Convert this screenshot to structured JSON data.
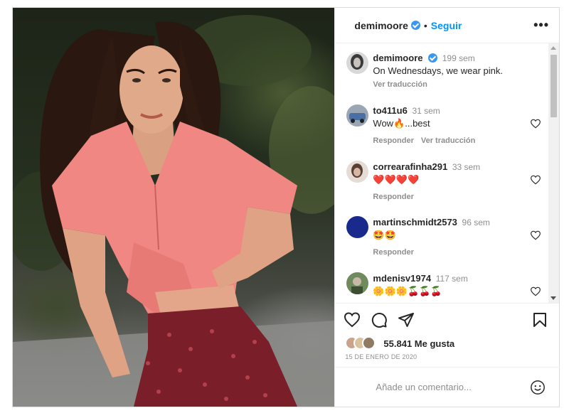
{
  "post": {
    "username": "demimoore",
    "follow_label": "Seguir",
    "separator": "•",
    "more_label": "•••",
    "caption": {
      "username": "demimoore",
      "time": "199 sem",
      "text": "On Wednesdays, we wear pink.",
      "translate": "Ver traducción"
    },
    "comments": [
      {
        "username": "to411u6",
        "time": "31 sem",
        "text": "Wow🔥...best",
        "reply": "Responder",
        "translate": "Ver traducción"
      },
      {
        "username": "correarafinha291",
        "time": "33 sem",
        "text": "❤️❤️❤️❤️",
        "reply": "Responder"
      },
      {
        "username": "martinschmidt2573",
        "time": "96 sem",
        "text": "🤩🤩",
        "reply": "Responder"
      },
      {
        "username": "mdenisv1974",
        "time": "117 sem",
        "text": "🌼🌼🌼🍒🍒🍒"
      }
    ],
    "likes_text": "55.841 Me gusta",
    "date": "15 DE ENERO DE 2020",
    "comment_placeholder": "Añade un comentario..."
  },
  "icons": {
    "like": "heart-icon",
    "comment": "comment-icon",
    "share": "share-icon",
    "save": "bookmark-icon",
    "emoji": "emoji-icon",
    "verified": "verified-badge-icon"
  },
  "colors": {
    "accent": "#0095f6",
    "verified": "#3897f0",
    "muted": "#8e8e8e"
  }
}
